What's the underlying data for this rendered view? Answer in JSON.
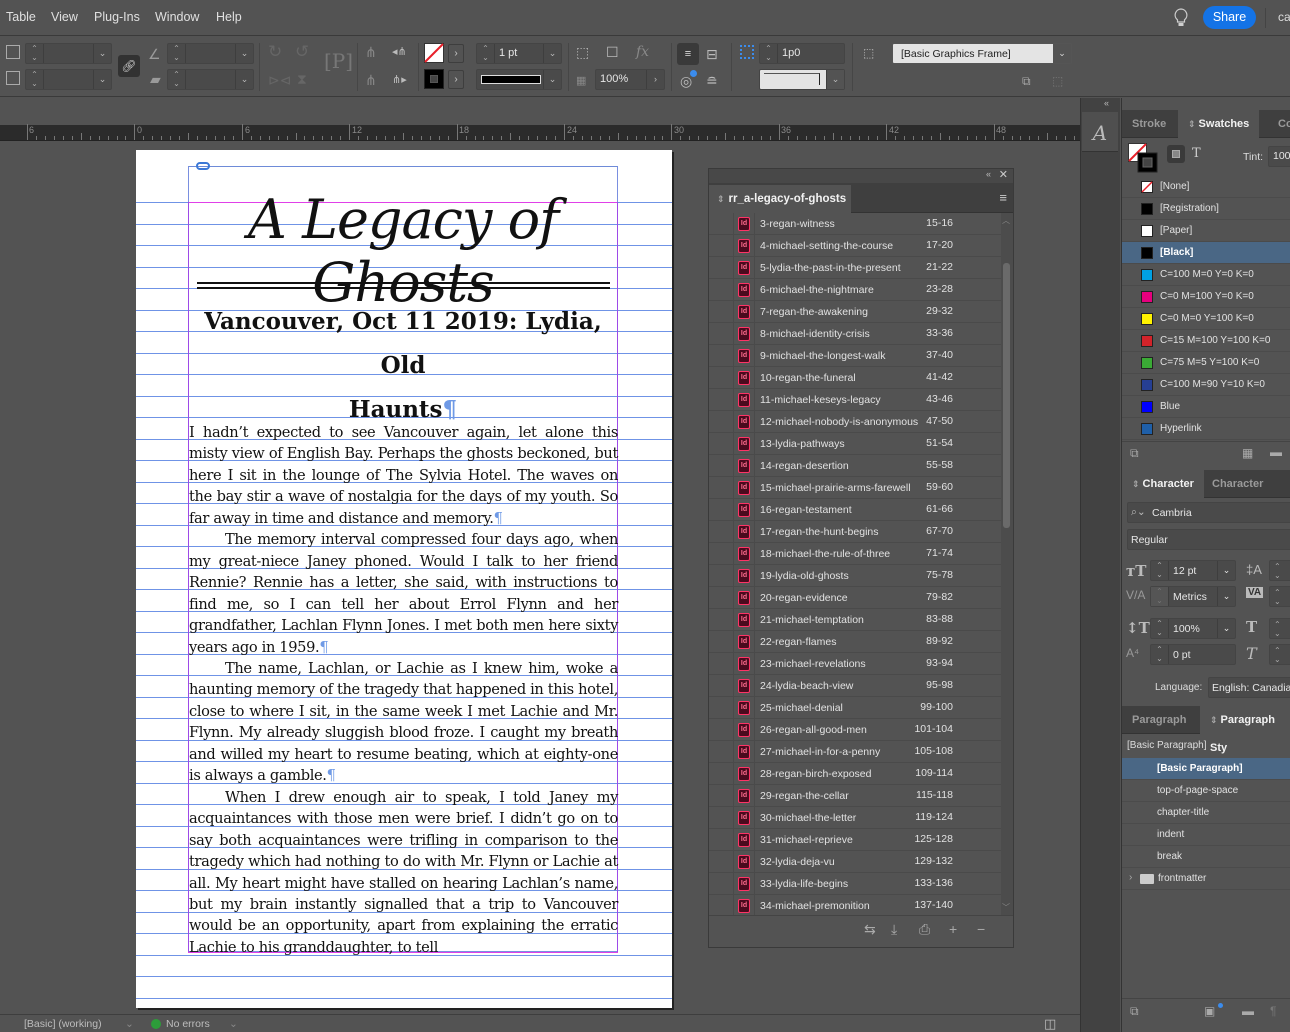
{
  "menubar": {
    "items": [
      "Table",
      "View",
      "Plug-Ins",
      "Window",
      "Help"
    ],
    "share_label": "Share",
    "account_label": "ca"
  },
  "controlbar": {
    "stroke_weight": "1 pt",
    "opacity": "100%",
    "offset": "1p0",
    "object_style": "[Basic Graphics Frame]",
    "colors": {
      "accent": "#1473e6",
      "none_slash": "#e8202a"
    }
  },
  "ruler": {
    "labels": [
      "6",
      "0",
      "6",
      "12",
      "18",
      "24",
      "30",
      "36",
      "42",
      "48"
    ]
  },
  "document": {
    "book_title": "A Legacy of Ghosts",
    "chapter_title_line1": "Vancouver, Oct 11 2019: Lydia, Old",
    "chapter_title_line2": "Haunts",
    "pilcrow": "¶",
    "paragraphs": [
      "I hadn’t expected to see Vancouver again, let alone this misty view of English Bay. Perhaps the ghosts beckoned, but here I sit in the lounge of The Sylvia Hotel. The waves on the bay stir a wave of nostalgia for the days of my youth. So far away in time and distance and memory.",
      "The memory interval compressed four days ago, when my great-niece Janey phoned. Would I talk to her friend Rennie? Rennie has a letter, she said, with instructions to find me, so I can tell her about Errol Flynn and her grandfather, Lachlan Flynn Jones. I met both men here sixty years ago in 1959.",
      "The name, Lachlan, or Lachie as I knew him, woke a haunting memory of the tragedy that happened in this hotel, close to where I sit, in the same week I met Lachie and Mr. Flynn. My already sluggish blood froze. I caught my breath and willed my heart to resume beating, which at eighty-one is always a gamble.",
      "When I drew enough air to speak, I told Janey my acquaintances with those men were brief. I didn’t go on to say both acquaintances were trifling in comparison to the tragedy which had nothing to do with Mr. Flynn or Lachie at all. My heart might have stalled on hearing Lachlan’s name, but my brain instantly signalled that a trip to Vancouver would be an opportunity, apart from explaining the erratic Lachie to his granddaughter, to tell"
    ]
  },
  "book_panel": {
    "title": "rr_a-legacy-of-ghosts",
    "documents": [
      {
        "name": "3-regan-witness",
        "pages": "15-16"
      },
      {
        "name": "4-michael-setting-the-course",
        "pages": "17-20"
      },
      {
        "name": "5-lydia-the-past-in-the-present",
        "pages": "21-22"
      },
      {
        "name": "6-michael-the-nightmare",
        "pages": "23-28"
      },
      {
        "name": "7-regan-the-awakening",
        "pages": "29-32"
      },
      {
        "name": "8-michael-identity-crisis",
        "pages": "33-36"
      },
      {
        "name": "9-michael-the-longest-walk",
        "pages": "37-40"
      },
      {
        "name": "10-regan-the-funeral",
        "pages": "41-42"
      },
      {
        "name": "11-michael-keseys-legacy",
        "pages": "43-46"
      },
      {
        "name": "12-michael-nobody-is-anonymous",
        "pages": "47-50"
      },
      {
        "name": "13-lydia-pathways",
        "pages": "51-54"
      },
      {
        "name": "14-regan-desertion",
        "pages": "55-58"
      },
      {
        "name": "15-michael-prairie-arms-farewell",
        "pages": "59-60"
      },
      {
        "name": "16-regan-testament",
        "pages": "61-66"
      },
      {
        "name": "17-regan-the-hunt-begins",
        "pages": "67-70"
      },
      {
        "name": "18-michael-the-rule-of-three",
        "pages": "71-74"
      },
      {
        "name": "19-lydia-old-ghosts",
        "pages": "75-78"
      },
      {
        "name": "20-regan-evidence",
        "pages": "79-82"
      },
      {
        "name": "21-michael-temptation",
        "pages": "83-88"
      },
      {
        "name": "22-regan-flames",
        "pages": "89-92"
      },
      {
        "name": "23-michael-revelations",
        "pages": "93-94"
      },
      {
        "name": "24-lydia-beach-view",
        "pages": "95-98"
      },
      {
        "name": "25-michael-denial",
        "pages": "99-100"
      },
      {
        "name": "26-regan-all-good-men",
        "pages": "101-104"
      },
      {
        "name": "27-michael-in-for-a-penny",
        "pages": "105-108"
      },
      {
        "name": "28-regan-birch-exposed",
        "pages": "109-114"
      },
      {
        "name": "29-regan-the-cellar",
        "pages": "115-118"
      },
      {
        "name": "30-michael-the-letter",
        "pages": "119-124"
      },
      {
        "name": "31-michael-reprieve",
        "pages": "125-128"
      },
      {
        "name": "32-lydia-deja-vu",
        "pages": "129-132"
      },
      {
        "name": "33-lydia-life-begins",
        "pages": "133-136"
      },
      {
        "name": "34-michael-premonition",
        "pages": "137-140"
      }
    ]
  },
  "swatches_panel": {
    "tabs": [
      "Stroke",
      "Swatches",
      "Colo"
    ],
    "tint_label": "Tint:",
    "tint_value": "100",
    "swatches": [
      {
        "name": "[None]",
        "color": "none"
      },
      {
        "name": "[Registration]",
        "color": "#000000"
      },
      {
        "name": "[Paper]",
        "color": "#ffffff"
      },
      {
        "name": "[Black]",
        "color": "#000000",
        "selected": true
      },
      {
        "name": "C=100 M=0 Y=0 K=0",
        "color": "#00a0e3"
      },
      {
        "name": "C=0 M=100 Y=0 K=0",
        "color": "#e6007e"
      },
      {
        "name": "C=0 M=0 Y=100 K=0",
        "color": "#fff200"
      },
      {
        "name": "C=15 M=100 Y=100 K=0",
        "color": "#d2232a"
      },
      {
        "name": "C=75 M=5 Y=100 K=0",
        "color": "#3aaa35"
      },
      {
        "name": "C=100 M=90 Y=10 K=0",
        "color": "#263f93"
      },
      {
        "name": "Blue",
        "color": "#0000ff"
      },
      {
        "name": "Hyperlink",
        "color": "#1f5fa8"
      }
    ]
  },
  "character_panel": {
    "tabs": [
      "Character",
      "Character Style"
    ],
    "font_family": "Cambria",
    "font_style": "Regular",
    "font_size": "12 pt",
    "kerning": "Metrics",
    "vertical_scale": "100%",
    "baseline_shift": "0 pt",
    "language_label": "Language:",
    "language": "English: Canadian"
  },
  "paragraph_panel": {
    "tabs": [
      "Paragraph",
      "Paragraph Sty"
    ],
    "current_style": "[Basic Paragraph]",
    "styles": [
      {
        "name": "[Basic Paragraph]",
        "selected": true
      },
      {
        "name": "top-of-page-space"
      },
      {
        "name": "chapter-title"
      },
      {
        "name": "indent"
      },
      {
        "name": "break"
      }
    ],
    "group": "frontmatter"
  },
  "statusbar": {
    "profile": "[Basic] (working)",
    "preflight": "No errors",
    "preflight_color": "#2d9d3a"
  }
}
